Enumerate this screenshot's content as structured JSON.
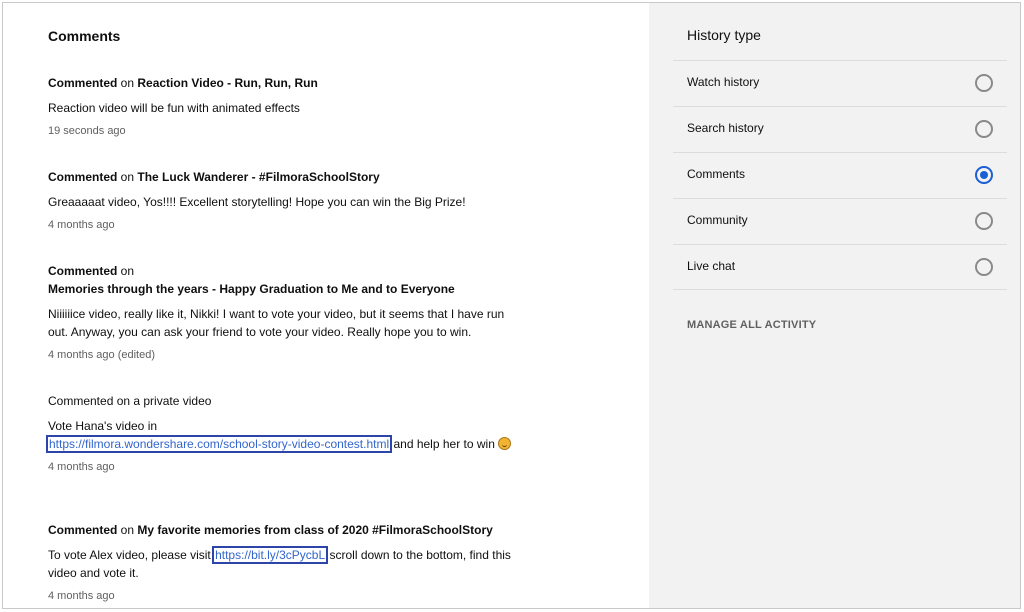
{
  "main": {
    "title": "Comments",
    "comments": [
      {
        "prefix": "Commented",
        "on_word": " on ",
        "video": "Reaction Video - Run, Run, Run",
        "text": "Reaction video will be fun with animated effects",
        "time": "19 seconds ago"
      },
      {
        "prefix": "Commented",
        "on_word": " on ",
        "video": "The Luck Wanderer - #FilmoraSchoolStory",
        "text": "Greaaaaat video, Yos!!!! Excellent storytelling! Hope you can win the Big Prize!",
        "time": "4 months ago"
      },
      {
        "prefix": "Commented",
        "on_word": " on",
        "video": "Memories through the years - Happy Graduation to Me and to Everyone",
        "text": "Niiiiiice video, really like it, Nikki! I want to vote your video, but it seems that I have run out. Anyway, you can ask your friend to vote your video. Really hope you to win.",
        "time": "4 months ago (edited)"
      },
      {
        "head": "Commented on a private video",
        "text_before": "Vote Hana's video in",
        "link": "https://filmora.wondershare.com/school-story-video-contest.html",
        "text_after": " and help her to win ",
        "emoji": "grinning-face-emoji",
        "time": "4 months ago"
      },
      {
        "prefix": "Commented",
        "on_word": " on ",
        "video": "My favorite memories from class of 2020 #FilmoraSchoolStory",
        "text_before": "To vote Alex video, please visit ",
        "link": "https://bit.ly/3cPycbL",
        "text_after": " scroll down to the bottom, find this video and vote it.",
        "time": "4 months ago"
      }
    ]
  },
  "sidebar": {
    "title": "History type",
    "items": [
      {
        "label": "Watch history",
        "selected": false
      },
      {
        "label": "Search history",
        "selected": false
      },
      {
        "label": "Comments",
        "selected": true
      },
      {
        "label": "Community",
        "selected": false
      },
      {
        "label": "Live chat",
        "selected": false
      }
    ],
    "manage_label": "MANAGE ALL ACTIVITY"
  },
  "colors": {
    "accent": "#1a5fd6",
    "link": "#3366cc",
    "highlight_box": "#2d44a8",
    "sidebar_bg": "#f2f2f2"
  }
}
